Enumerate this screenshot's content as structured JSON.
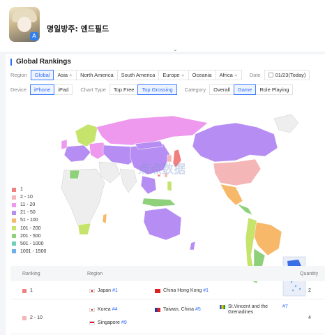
{
  "app": {
    "name": "명일방주: 엔드필드",
    "store_badge": "A"
  },
  "section": {
    "title": "Global Rankings"
  },
  "filters": {
    "region": {
      "label": "Region",
      "options": [
        "Global",
        "Asia",
        "North America",
        "South America",
        "Europe",
        "Oceania",
        "Africa"
      ],
      "active": "Global"
    },
    "date": {
      "label": "Date",
      "value": "01/23(Today)"
    },
    "device": {
      "label": "Device",
      "options": [
        "iPhone",
        "iPad"
      ],
      "active": "iPhone"
    },
    "chart_type": {
      "label": "Chart Type",
      "options": [
        "Top Free",
        "Top Grossing"
      ],
      "active": "Top Grossing"
    },
    "category": {
      "label": "Category",
      "options": [
        "Overall",
        "Game",
        "Role Playing"
      ],
      "active": "Game"
    }
  },
  "legend": [
    {
      "label": "1",
      "color": "#f08080"
    },
    {
      "label": "2 - 10",
      "color": "#f4b6b6"
    },
    {
      "label": "11 - 20",
      "color": "#ee99ee"
    },
    {
      "label": "21 - 50",
      "color": "#b68ef3"
    },
    {
      "label": "51 - 100",
      "color": "#f7b869"
    },
    {
      "label": "101 - 200",
      "color": "#c6e36b"
    },
    {
      "label": "201 - 500",
      "color": "#8fd07a"
    },
    {
      "label": "501 - 1000",
      "color": "#6fd0b8"
    },
    {
      "label": "1001 - 1500",
      "color": "#6fb0e6"
    }
  ],
  "watermark": "点点数据",
  "table": {
    "headers": {
      "ranking": "Ranking",
      "region": "Region",
      "quantity": "Quantity"
    },
    "rows": [
      {
        "ranking": "1",
        "color": "#f08080",
        "quantity": "2",
        "regions": [
          {
            "name": "Japan",
            "rank": "#1"
          },
          {
            "name": "China Hong Kong",
            "rank": "#1"
          }
        ]
      },
      {
        "ranking": "2 - 10",
        "color": "#f4b6b6",
        "quantity": "4",
        "regions": [
          {
            "name": "Korea",
            "rank": "#4"
          },
          {
            "name": "Taiwan, China",
            "rank": "#5"
          },
          {
            "name": "St.Vincent and the Grenadines",
            "rank": "#7"
          },
          {
            "name": "Singapore",
            "rank": "#9"
          }
        ]
      }
    ]
  }
}
